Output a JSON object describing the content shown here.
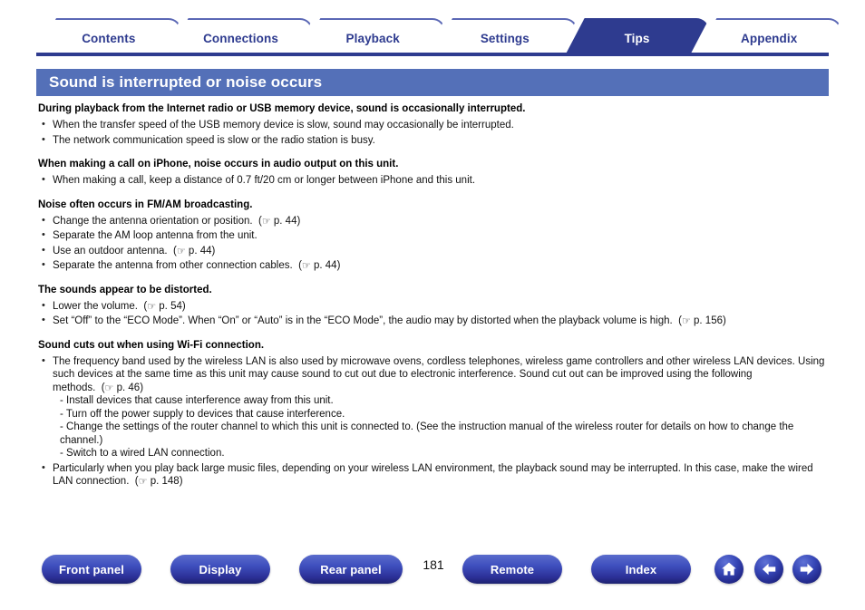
{
  "tabs": [
    {
      "label": "Contents",
      "active": false
    },
    {
      "label": "Connections",
      "active": false
    },
    {
      "label": "Playback",
      "active": false
    },
    {
      "label": "Settings",
      "active": false
    },
    {
      "label": "Tips",
      "active": true
    },
    {
      "label": "Appendix",
      "active": false
    }
  ],
  "page": {
    "title": "Sound is interrupted or noise occurs",
    "number": "181",
    "title_bar_color": "#5470b8",
    "active_tab_color": "#2e3b8f",
    "tab_text_color": "#2e3b8f"
  },
  "sections": [
    {
      "heading": "During playback from the Internet radio or USB memory device, sound is occasionally interrupted.",
      "bullets": [
        {
          "text": "When the transfer speed of the USB memory device is slow, sound may occasionally be interrupted.",
          "ref": ""
        },
        {
          "text": "The network communication speed is slow or the radio station is busy.",
          "ref": ""
        }
      ]
    },
    {
      "heading": "When making a call on iPhone, noise occurs in audio output on this unit.",
      "bullets": [
        {
          "text": "When making a call, keep a distance of 0.7 ft/20 cm or longer between iPhone and this unit.",
          "ref": ""
        }
      ]
    },
    {
      "heading": "Noise often occurs in FM/AM broadcasting.",
      "bullets": [
        {
          "text": "Change the antenna orientation or position.",
          "ref": "p. 44"
        },
        {
          "text": "Separate the AM loop antenna from the unit.",
          "ref": ""
        },
        {
          "text": "Use an outdoor antenna.",
          "ref": "p. 44"
        },
        {
          "text": "Separate the antenna from other connection cables.",
          "ref": "p. 44"
        }
      ]
    },
    {
      "heading": "The sounds appear to be distorted.",
      "bullets": [
        {
          "text": "Lower the volume.",
          "ref": "p. 54"
        },
        {
          "text": "Set “Off” to the “ECO Mode”. When “On” or “Auto” is in the “ECO Mode”, the audio may by distorted when the playback volume is high.",
          "ref": "p. 156"
        }
      ]
    },
    {
      "heading": "Sound cuts out when using Wi-Fi connection.",
      "bullets": [
        {
          "text": "The frequency band used by the wireless LAN is also used by microwave ovens, cordless telephones, wireless game controllers and other wireless LAN devices. Using such devices at the same time as this unit may cause sound to cut out due to electronic interference. Sound cut out can be improved using the following methods.",
          "ref": "p. 46",
          "sublines": [
            "- Install devices that cause interference away from this unit.",
            "- Turn off the power supply to devices that cause interference.",
            "- Change the settings of the router channel to which this unit is connected to. (See the instruction manual of the wireless router for details on how to change the channel.)",
            "- Switch to a wired LAN connection."
          ]
        },
        {
          "text": "Particularly when you play back large music files, depending on your wireless LAN environment, the playback sound may be interrupted. In this case, make the wired LAN connection.",
          "ref": "p. 148"
        }
      ]
    }
  ],
  "footer": {
    "buttons": [
      {
        "label": "Front panel"
      },
      {
        "label": "Display"
      },
      {
        "label": "Rear panel"
      },
      {
        "label": "Remote"
      },
      {
        "label": "Index"
      }
    ],
    "icons": [
      {
        "name": "home-icon"
      },
      {
        "name": "arrow-left-icon"
      },
      {
        "name": "arrow-right-icon"
      }
    ]
  },
  "ref_icon": "☞"
}
